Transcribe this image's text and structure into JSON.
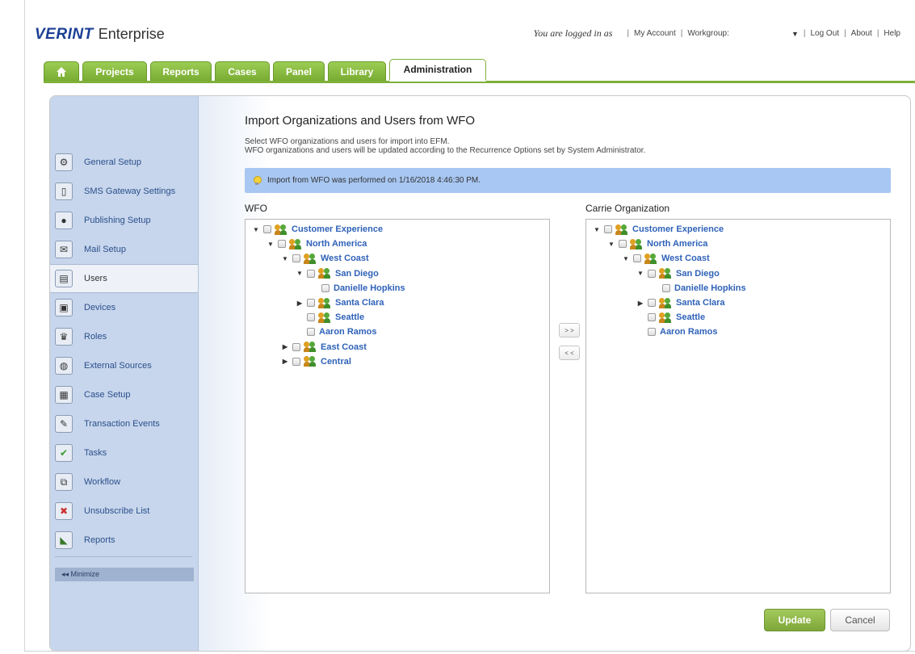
{
  "header": {
    "brand": "VERINT",
    "product": "Enterprise",
    "logged_in_text": "You are logged in as",
    "links": {
      "my_account": "My Account",
      "workgroup": "Workgroup:",
      "log_out": "Log Out",
      "about": "About",
      "help": "Help"
    },
    "workgroup_selected": "▼"
  },
  "tabs": [
    {
      "label": "",
      "icon": "home-icon"
    },
    {
      "label": "Projects"
    },
    {
      "label": "Reports"
    },
    {
      "label": "Cases"
    },
    {
      "label": "Panel"
    },
    {
      "label": "Library"
    },
    {
      "label": "Administration",
      "active": true
    }
  ],
  "sidebar": {
    "items": [
      {
        "label": "General Setup",
        "icon": "general-setup-icon"
      },
      {
        "label": "SMS Gateway Settings",
        "icon": "phone-icon"
      },
      {
        "label": "Publishing Setup",
        "icon": "publishing-icon"
      },
      {
        "label": "Mail Setup",
        "icon": "mail-icon"
      },
      {
        "label": "Users",
        "icon": "users-icon",
        "active": true
      },
      {
        "label": "Devices",
        "icon": "devices-icon"
      },
      {
        "label": "Roles",
        "icon": "roles-icon"
      },
      {
        "label": "External Sources",
        "icon": "globe-icon"
      },
      {
        "label": "Case Setup",
        "icon": "case-icon"
      },
      {
        "label": "Transaction Events",
        "icon": "transaction-icon"
      },
      {
        "label": "Tasks",
        "icon": "checkmark-icon"
      },
      {
        "label": "Workflow",
        "icon": "workflow-icon"
      },
      {
        "label": "Unsubscribe List",
        "icon": "unsubscribe-icon"
      },
      {
        "label": "Reports",
        "icon": "chart-icon"
      }
    ],
    "minimize": "◂◂  Minimize"
  },
  "main": {
    "title": "Import Organizations and Users from WFO",
    "description_line1": "Select WFO organizations and users for import into EFM.",
    "description_line2": "WFO organizations and users will be updated according to the Recurrence Options set by System Administrator.",
    "info": "Import from WFO was performed on 1/16/2018 4:46:30 PM.",
    "left_label": "WFO",
    "right_label": "Carrie Organization",
    "left_tree": [
      {
        "label": "Customer Experience",
        "expander": "down",
        "group": true
      },
      {
        "label": "North America",
        "expander": "down",
        "group": true
      },
      {
        "label": "West Coast",
        "expander": "down",
        "group": true
      },
      {
        "label": "San Diego",
        "expander": "down",
        "group": true
      },
      {
        "label": "Danielle Hopkins",
        "expander": "none",
        "group": false
      },
      {
        "label": "Santa Clara",
        "expander": "right",
        "group": true
      },
      {
        "label": "Seattle",
        "expander": "none",
        "group": true
      },
      {
        "label": "Aaron Ramos",
        "expander": "none",
        "group": false
      },
      {
        "label": "East Coast",
        "expander": "right",
        "group": true
      },
      {
        "label": "Central",
        "expander": "right",
        "group": true
      }
    ],
    "right_tree": [
      {
        "label": "Customer Experience",
        "expander": "down",
        "group": true
      },
      {
        "label": "North America",
        "expander": "down",
        "group": true
      },
      {
        "label": "West Coast",
        "expander": "down",
        "group": true
      },
      {
        "label": "San Diego",
        "expander": "down",
        "group": true
      },
      {
        "label": "Danielle Hopkins",
        "expander": "none",
        "group": false
      },
      {
        "label": "Santa Clara",
        "expander": "right",
        "group": true
      },
      {
        "label": "Seattle",
        "expander": "none",
        "group": true
      },
      {
        "label": "Aaron Ramos",
        "expander": "none",
        "group": false
      }
    ],
    "move_right": "> >",
    "move_left": "< <",
    "update_label": "Update",
    "cancel_label": "Cancel"
  },
  "colors": {
    "brand": "#1c3f94",
    "tab_green": "#7fb03a",
    "sidebar": "#c7d6ec",
    "info_bar": "#a8c7f2",
    "tree_link": "#2f62b8"
  }
}
